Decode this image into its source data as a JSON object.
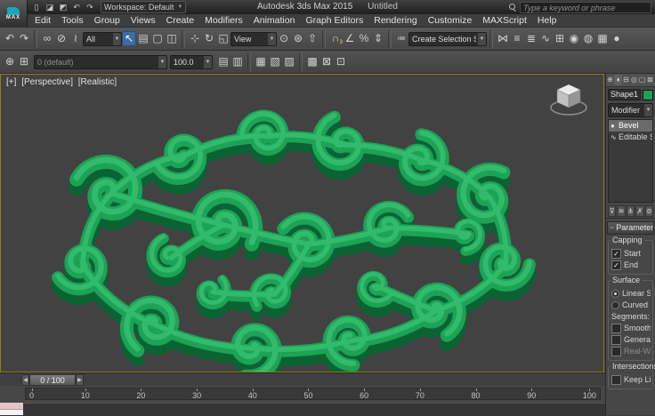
{
  "app": {
    "logo": "MAX",
    "title": "Autodesk 3ds Max 2015",
    "document": "Untitled",
    "workspace": "Workspace: Default",
    "search_placeholder": "Type a keyword or phrase"
  },
  "menus": [
    "Edit",
    "Tools",
    "Group",
    "Views",
    "Create",
    "Modifiers",
    "Animation",
    "Graph Editors",
    "Rendering",
    "Customize",
    "MAXScript",
    "Help"
  ],
  "toolbar": {
    "selection_filter": "All",
    "reference_coordinate_system": "View",
    "named_selection_set": "Create Selection Set",
    "snap_mode": "3"
  },
  "layers_toolbar": {
    "current_layer": "0 (default)",
    "percent": "100.0"
  },
  "viewport": {
    "nav": "[+]",
    "view": "[Perspective]",
    "shading": "[Realistic]"
  },
  "command_panel": {
    "object_name": "Shape1",
    "modifier_list": "Modifier List",
    "stack": [
      {
        "name": "Bevel",
        "icon": "bulb",
        "selected": true
      },
      {
        "name": "Editable Spline",
        "icon": "spline",
        "selected": false
      }
    ],
    "rollout": "Parameters",
    "groups": {
      "capping": {
        "label": "Capping",
        "start": "Start",
        "end": "End"
      },
      "surface": {
        "label": "Surface",
        "linear": "Linear Sides",
        "curved": "Curved Sides",
        "segments": "Segments:",
        "smooth": "Smooth Across Levels",
        "generate": "Generate Mapping Coords.",
        "realworld": "Real-World Map Size"
      },
      "intersections": {
        "label": "Intersections",
        "keep": "Keep Lines From Crossing"
      }
    }
  },
  "timeline": {
    "slider": "0 / 100",
    "ticks": [
      0,
      10,
      20,
      30,
      40,
      50,
      60,
      70,
      80,
      90,
      100
    ]
  },
  "colors": {
    "object_top": "#1da355",
    "object_side": "#0b6233",
    "object_highlight": "#33bb6d",
    "viewport_bg": "#424242",
    "active_tool_blue": "#3d6da0"
  },
  "icons": {
    "app_new": "▯",
    "app_open": "◪",
    "app_save": "◩",
    "app_undo": "↶",
    "app_redo": "↷",
    "undo": "↶",
    "redo": "↷",
    "link": "∞",
    "unlink": "⊘",
    "bind": "≀",
    "select": "↖",
    "select_by_name": "▤",
    "region": "▢",
    "window_crossing": "◫",
    "move": "⊹",
    "rotate": "↻",
    "scale": "◱",
    "pivot": "⊙",
    "manipulate": "⊛",
    "keyboard": "⇧",
    "snap": "∩",
    "angle_snap": "∠",
    "percent_snap": "%",
    "spinner_snap": "⇕",
    "edit_sets": "≔",
    "mirror": "⋈",
    "align": "≡",
    "layer_mgr": "≣",
    "graph_ed": "∿",
    "schematic": "⊞",
    "material": "◉",
    "render_setup": "◍",
    "render_frame": "▦",
    "render": "●",
    "layer_new": "⊕",
    "layer_add": "⊞",
    "r2a": "▤",
    "r2b": "▥",
    "r2c": "▦",
    "r2d": "▧",
    "r2e": "▨",
    "r2f": "▩",
    "r2g": "⊠",
    "r2h": "⊡",
    "tab_create": "⊕",
    "tab_modify": "◖",
    "tab_hierarchy": "⊟",
    "tab_motion": "◎",
    "tab_display": "▢",
    "tab_utilities": "⊠",
    "bulb": "●",
    "spline": "∿",
    "pin": "⊽",
    "show_end": "≋",
    "make_unique": "⋔",
    "remove_mod": "✗",
    "configure": "⊜",
    "prev_frame": "◀",
    "next_frame": "▶",
    "combo_arrow": "▼",
    "check": "✓"
  }
}
